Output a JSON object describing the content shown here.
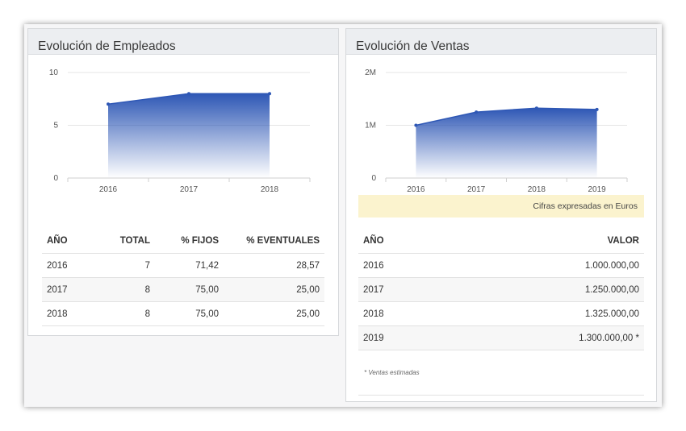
{
  "employees": {
    "title": "Evolución de Empleados",
    "chart_data": {
      "type": "area",
      "x": [
        "2016",
        "2017",
        "2018"
      ],
      "series": [
        {
          "values": [
            7,
            8,
            8
          ]
        }
      ],
      "ylim": [
        0,
        10
      ],
      "yticks": [
        "0",
        "5",
        "10"
      ],
      "grid": true,
      "color": "#2e57b5"
    },
    "columns": [
      "AÑO",
      "TOTAL",
      "% FIJOS",
      "% EVENTUALES"
    ],
    "rows": [
      [
        "2016",
        "7",
        "71,42",
        "28,57"
      ],
      [
        "2017",
        "8",
        "75,00",
        "25,00"
      ],
      [
        "2018",
        "8",
        "75,00",
        "25,00"
      ]
    ]
  },
  "sales": {
    "title": "Evolución de Ventas",
    "chart_data": {
      "type": "area",
      "x": [
        "2016",
        "2017",
        "2018",
        "2019"
      ],
      "series": [
        {
          "values": [
            1000000,
            1250000,
            1325000,
            1300000
          ]
        }
      ],
      "ylim": [
        0,
        2000000
      ],
      "yticks": [
        "0",
        "1M",
        "2M"
      ],
      "grid": true,
      "color": "#2e57b5"
    },
    "note": "Cifras expresadas en Euros",
    "columns": [
      "AÑO",
      "VALOR"
    ],
    "rows": [
      [
        "2016",
        "1.000.000,00"
      ],
      [
        "2017",
        "1.250.000,00"
      ],
      [
        "2018",
        "1.325.000,00"
      ],
      [
        "2019",
        "1.300.000,00 *"
      ]
    ],
    "footnote": "* Ventas estimadas"
  }
}
